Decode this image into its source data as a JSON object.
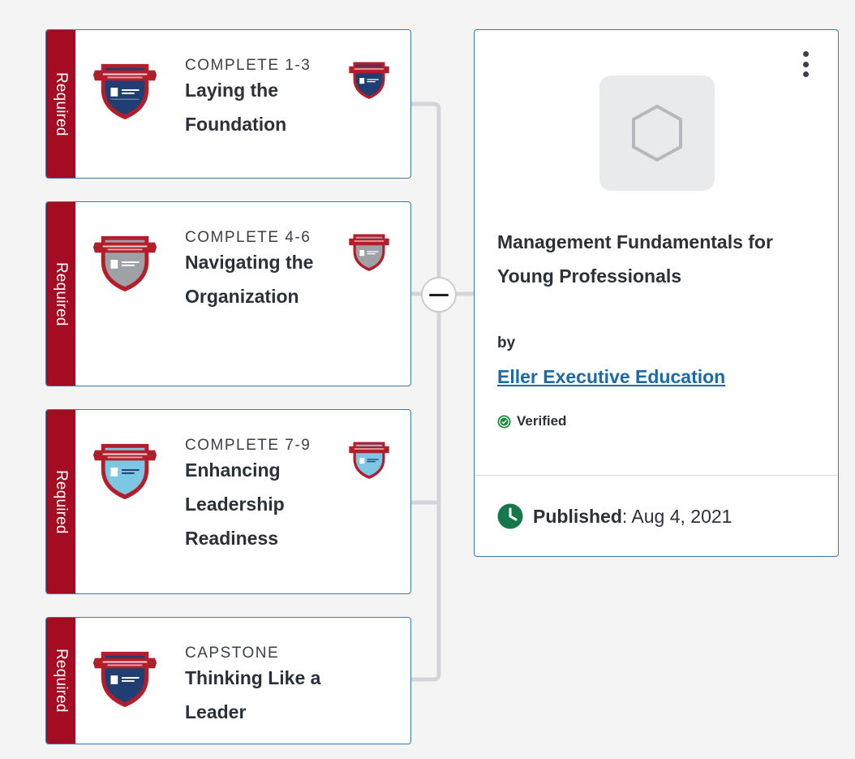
{
  "colors": {
    "required_band": "#a60c21",
    "card_border": "#3c78b0",
    "link": "#1a6aa8",
    "verified_green": "#1b8a3f",
    "clock_green": "#16784a"
  },
  "courses": [
    {
      "required_label": "Required",
      "kicker": "COMPLETE 1-3",
      "title": "Laying the Foundation",
      "badge_color": "#1f3f73",
      "show_small_badge": true
    },
    {
      "required_label": "Required",
      "kicker": "COMPLETE 4-6",
      "title": "Navigating the Organization",
      "badge_color": "#9ea1a6",
      "show_small_badge": true
    },
    {
      "required_label": "Required",
      "kicker": "COMPLETE 7-9",
      "title": "Enhancing Leadership Readiness",
      "badge_color": "#7cc7e3",
      "show_small_badge": true
    },
    {
      "required_label": "Required",
      "kicker": "CAPSTONE",
      "title": "Thinking Like a Leader",
      "badge_color": "#1f3f73",
      "show_small_badge": false
    }
  ],
  "program": {
    "title": "Management Fundamentals for Young Professionals",
    "by_label": "by",
    "organization": "Eller Executive Education",
    "verified_label": "Verified",
    "published_label": "Published",
    "published_date": ": Aug 4, 2021",
    "menu_icon": "vertical-ellipsis-icon",
    "placeholder_icon": "hexagon-icon"
  },
  "toggle_icon": "collapse-minus-icon"
}
